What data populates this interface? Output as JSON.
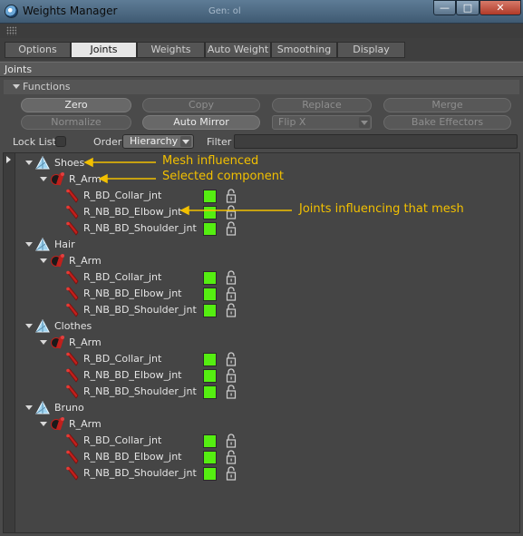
{
  "window": {
    "title": "Weights Manager",
    "ghost_text": "Gen: ol",
    "buttons": {
      "min": "—",
      "max": "□",
      "close": "✕"
    }
  },
  "tabs": [
    {
      "label": "Options",
      "active": false
    },
    {
      "label": "Joints",
      "active": true
    },
    {
      "label": "Weights",
      "active": false
    },
    {
      "label": "Auto Weight",
      "active": false
    },
    {
      "label": "Smoothing",
      "active": false
    },
    {
      "label": "Display",
      "active": false
    }
  ],
  "section_title": "Joints",
  "functions": {
    "title": "Functions",
    "buttons": {
      "zero": "Zero",
      "copy": "Copy",
      "replace": "Replace",
      "merge": "Merge",
      "normalize": "Normalize",
      "auto_mirror": "Auto Mirror",
      "flip": "Flip X",
      "bake_effectors": "Bake Effectors"
    }
  },
  "controls": {
    "lock_list": "Lock List",
    "lock_list_checked": false,
    "order_label": "Order",
    "order_value": "Hierarchy",
    "filter_label": "Filter",
    "filter_value": ""
  },
  "tree": [
    {
      "name": "Shoes",
      "component": "R_Arm",
      "joints": [
        "R_BD_Collar_jnt",
        "R_NB_BD_Elbow_jnt",
        "R_NB_BD_Shoulder_jnt"
      ]
    },
    {
      "name": "Hair",
      "component": "R_Arm",
      "joints": [
        "R_BD_Collar_jnt",
        "R_NB_BD_Elbow_jnt",
        "R_NB_BD_Shoulder_jnt"
      ]
    },
    {
      "name": "Clothes",
      "component": "R_Arm",
      "joints": [
        "R_BD_Collar_jnt",
        "R_NB_BD_Elbow_jnt",
        "R_NB_BD_Shoulder_jnt"
      ]
    },
    {
      "name": "Bruno",
      "component": "R_Arm",
      "joints": [
        "R_BD_Collar_jnt",
        "R_NB_BD_Elbow_jnt",
        "R_NB_BD_Shoulder_jnt"
      ]
    }
  ],
  "annotations": {
    "mesh": "Mesh influenced",
    "component": "Selected component",
    "joints": "Joints influencing that mesh"
  },
  "colors": {
    "weight_active": "#55ee11",
    "annotation": "#f2c000",
    "mesh_icon": "#9fd4f0",
    "joint_icon": "#c0201c"
  }
}
